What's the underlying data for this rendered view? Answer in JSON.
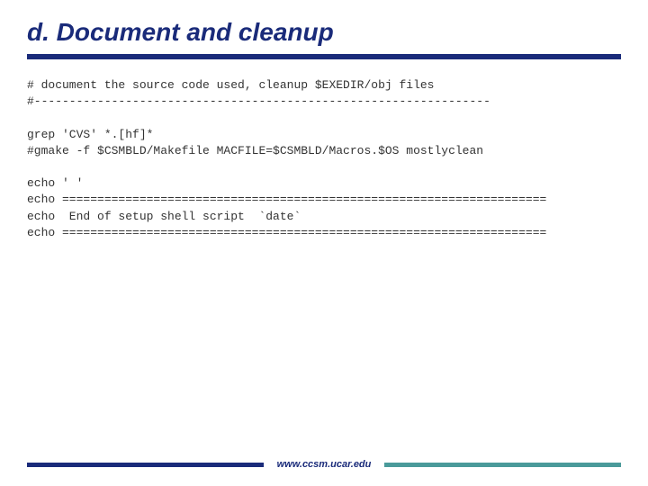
{
  "title": "d. Document and cleanup",
  "code": {
    "line1": "# document the source code used, cleanup $EXEDIR/obj files",
    "line2": "#-----------------------------------------------------------------",
    "line3": "",
    "line4": "grep 'CVS' *.[hf]*",
    "line5": "#gmake -f $CSMBLD/Makefile MACFILE=$CSMBLD/Macros.$OS mostlyclean",
    "line6": "",
    "line7": "echo ' '",
    "line8": "echo =====================================================================",
    "line9": "echo  End of setup shell script  `date`",
    "line10": "echo ====================================================================="
  },
  "footer": {
    "url": "www.ccsm.ucar.edu"
  }
}
